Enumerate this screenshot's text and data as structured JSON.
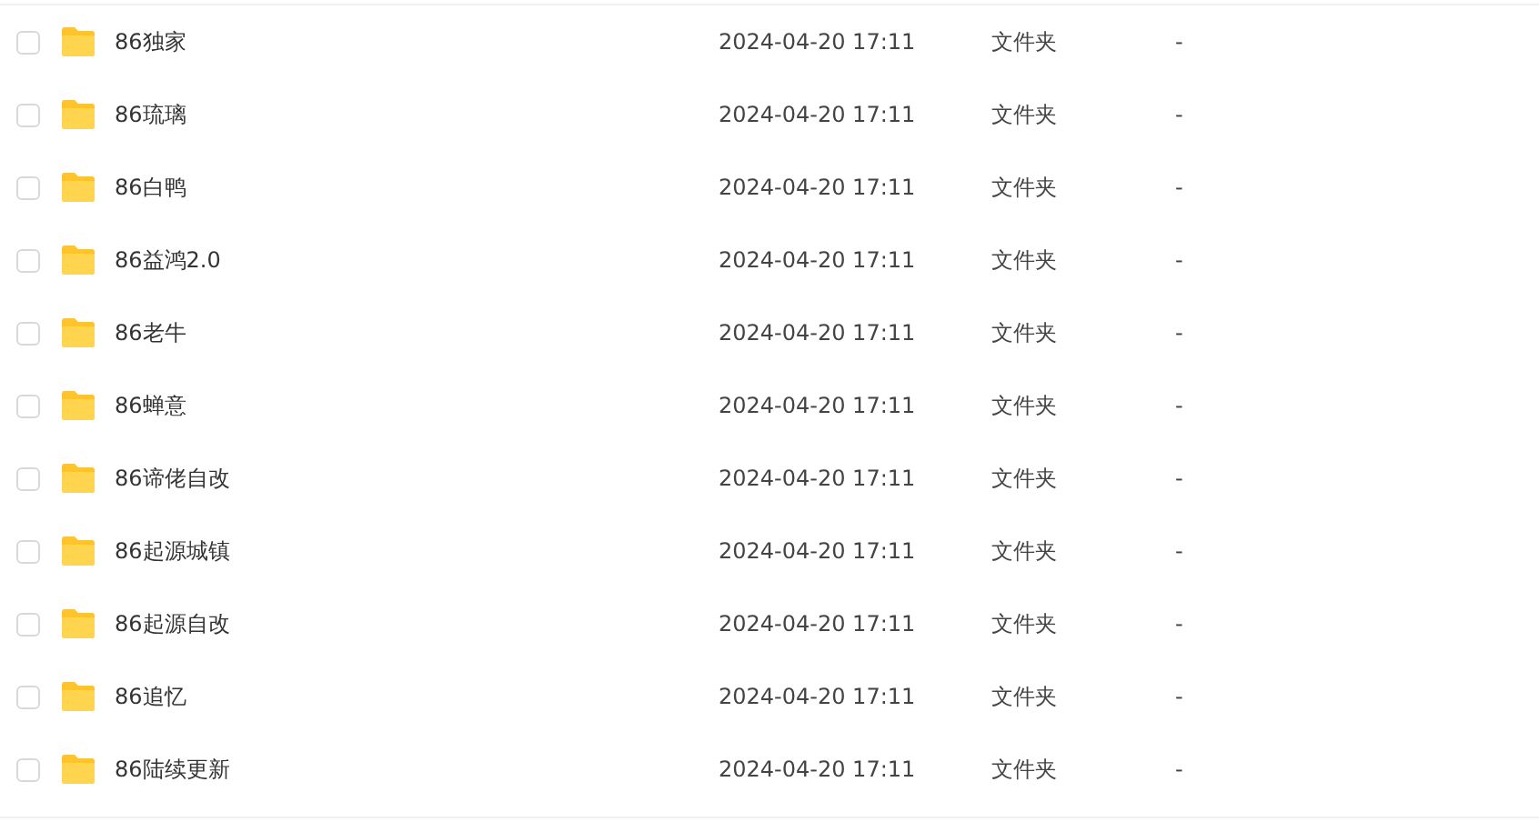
{
  "files": [
    {
      "name": "86独家",
      "modified": "2024-04-20 17:11",
      "type": "文件夹",
      "size": "-",
      "checked": false
    },
    {
      "name": "86琉璃",
      "modified": "2024-04-20 17:11",
      "type": "文件夹",
      "size": "-",
      "checked": false
    },
    {
      "name": "86白鸭",
      "modified": "2024-04-20 17:11",
      "type": "文件夹",
      "size": "-",
      "checked": false
    },
    {
      "name": "86益鸿2.0",
      "modified": "2024-04-20 17:11",
      "type": "文件夹",
      "size": "-",
      "checked": false
    },
    {
      "name": "86老牛",
      "modified": "2024-04-20 17:11",
      "type": "文件夹",
      "size": "-",
      "checked": false
    },
    {
      "name": "86蝉意",
      "modified": "2024-04-20 17:11",
      "type": "文件夹",
      "size": "-",
      "checked": false
    },
    {
      "name": "86谛佬自改",
      "modified": "2024-04-20 17:11",
      "type": "文件夹",
      "size": "-",
      "checked": false
    },
    {
      "name": "86起源城镇",
      "modified": "2024-04-20 17:11",
      "type": "文件夹",
      "size": "-",
      "checked": false
    },
    {
      "name": "86起源自改",
      "modified": "2024-04-20 17:11",
      "type": "文件夹",
      "size": "-",
      "checked": false
    },
    {
      "name": "86追忆",
      "modified": "2024-04-20 17:11",
      "type": "文件夹",
      "size": "-",
      "checked": false
    },
    {
      "name": "86陆续更新",
      "modified": "2024-04-20 17:11",
      "type": "文件夹",
      "size": "-",
      "checked": false
    }
  ]
}
